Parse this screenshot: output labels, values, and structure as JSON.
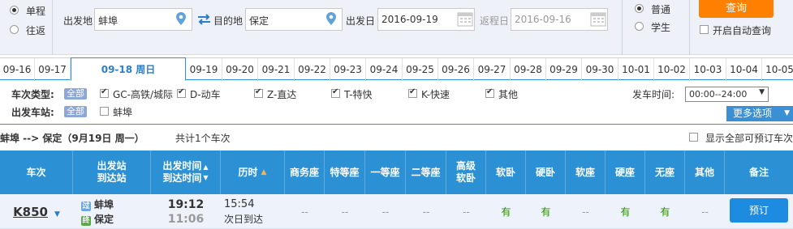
{
  "search": {
    "trip_one_way": "单程",
    "trip_round": "往返",
    "from_label": "出发地",
    "from_value": "蚌埠",
    "to_label": "目的地",
    "to_value": "保定",
    "depart_label": "出发日",
    "depart_value": "2016-09-19",
    "return_label": "返程日",
    "return_value": "2016-09-16",
    "type_normal": "普通",
    "type_student": "学生",
    "search_btn": "查询",
    "auto_query": "开启自动查询"
  },
  "dates": [
    "09-16",
    "09-17",
    "09-18 周日",
    "09-19",
    "09-20",
    "09-21",
    "09-22",
    "09-23",
    "09-24",
    "09-25",
    "09-26",
    "09-27",
    "09-28",
    "09-29",
    "09-30",
    "10-01",
    "10-02",
    "10-03",
    "10-04",
    "10-05"
  ],
  "filters": {
    "type_label": "车次类型:",
    "all": "全部",
    "types": [
      "GC-高铁/城际",
      "D-动车",
      "Z-直达",
      "T-特快",
      "K-快速",
      "其他"
    ],
    "station_label": "出发车站:",
    "stations": [
      "蚌埠"
    ],
    "time_label": "发车时间:",
    "time_value": "00:00--24:00",
    "more": "更多选项"
  },
  "summary": {
    "route": "蚌埠 --> 保定（9月19日  周一）",
    "count": "共计1个车次",
    "show_all": "显示全部可预订车次"
  },
  "table": {
    "h_train": "车次",
    "h_station_1": "出发站",
    "h_station_2": "到达站",
    "h_time_1": "出发时间",
    "h_time_2": "到达时间",
    "h_duration": "历时",
    "h_business": "商务座",
    "h_special": "特等座",
    "h_first": "一等座",
    "h_second": "二等座",
    "h_adv_1": "高级",
    "h_adv_2": "软卧",
    "h_soft_sleeper": "软卧",
    "h_hard_sleeper": "硬卧",
    "h_soft_seat": "软座",
    "h_hard_seat": "硬座",
    "h_no_seat": "无座",
    "h_other": "其他",
    "h_note": "备注",
    "row": {
      "train": "K850",
      "from_mark": "过",
      "from": "蚌埠",
      "to_mark": "终",
      "to": "保定",
      "depart": "19:12",
      "arrive": "11:06",
      "duration": "15:54",
      "arrive_note": "次日到达",
      "business": "--",
      "special": "--",
      "first": "--",
      "second": "--",
      "adv_soft": "--",
      "soft_sleeper": "有",
      "hard_sleeper": "有",
      "soft_seat": "--",
      "hard_seat": "有",
      "no_seat": "有",
      "other": "--",
      "book": "预订"
    }
  },
  "colors": {
    "accent": "#2b91d4",
    "search": "#ff8000",
    "available": "#2a8a00"
  }
}
